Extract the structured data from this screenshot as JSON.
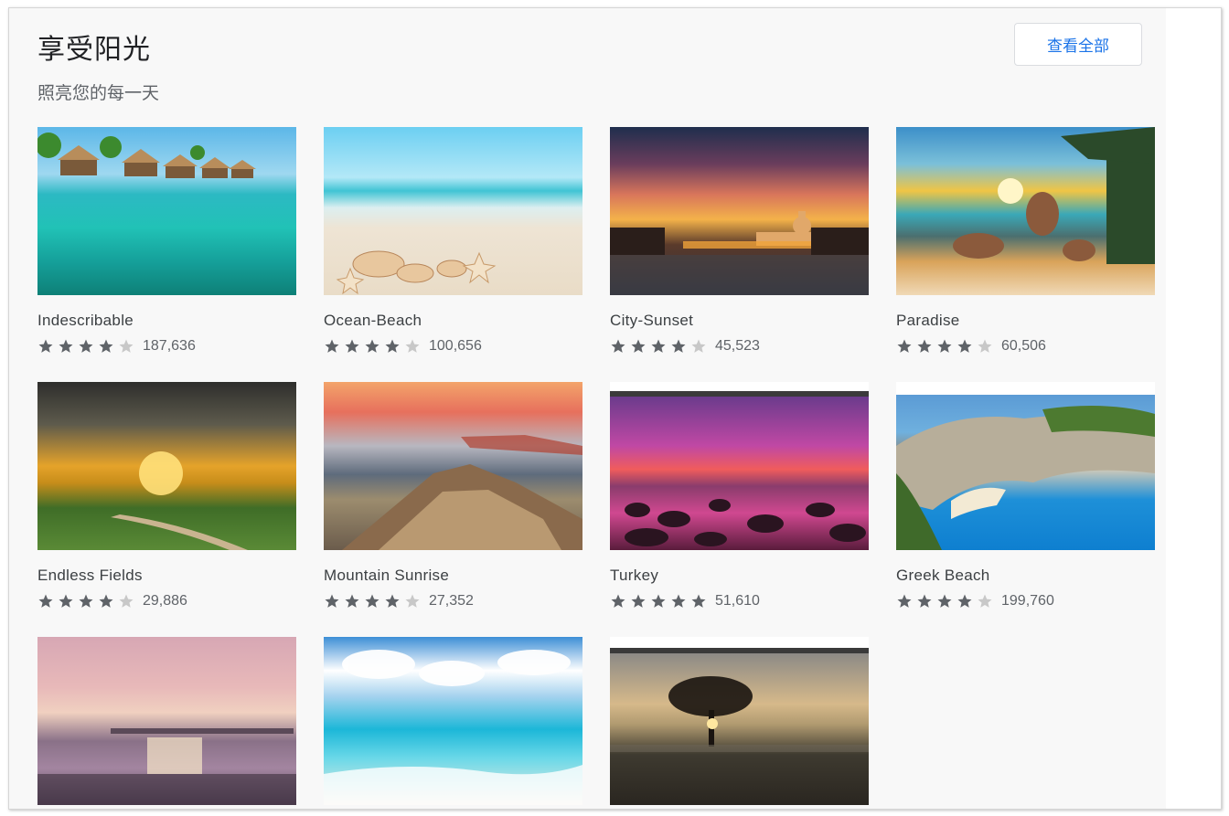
{
  "section": {
    "title": "享受阳光",
    "subtitle": "照亮您的每一天",
    "view_all_label": "查看全部"
  },
  "themes": [
    {
      "name": "Indescribable",
      "rating": 4,
      "count": "187,636"
    },
    {
      "name": "Ocean-Beach",
      "rating": 4,
      "count": "100,656"
    },
    {
      "name": "City-Sunset",
      "rating": 4,
      "count": "45,523"
    },
    {
      "name": "Paradise",
      "rating": 4,
      "count": "60,506"
    },
    {
      "name": "Endless Fields",
      "rating": 4,
      "count": "29,886"
    },
    {
      "name": "Mountain Sunrise",
      "rating": 4,
      "count": "27,352"
    },
    {
      "name": "Turkey",
      "rating": 5,
      "count": "51,610"
    },
    {
      "name": "Greek Beach",
      "rating": 4,
      "count": "199,760"
    },
    {
      "name": "",
      "rating": null,
      "count": ""
    },
    {
      "name": "",
      "rating": null,
      "count": ""
    },
    {
      "name": "",
      "rating": null,
      "count": ""
    }
  ],
  "colors": {
    "star_filled": "#5f6368",
    "star_empty": "#c8c8c8",
    "link_blue": "#1a73e8"
  }
}
